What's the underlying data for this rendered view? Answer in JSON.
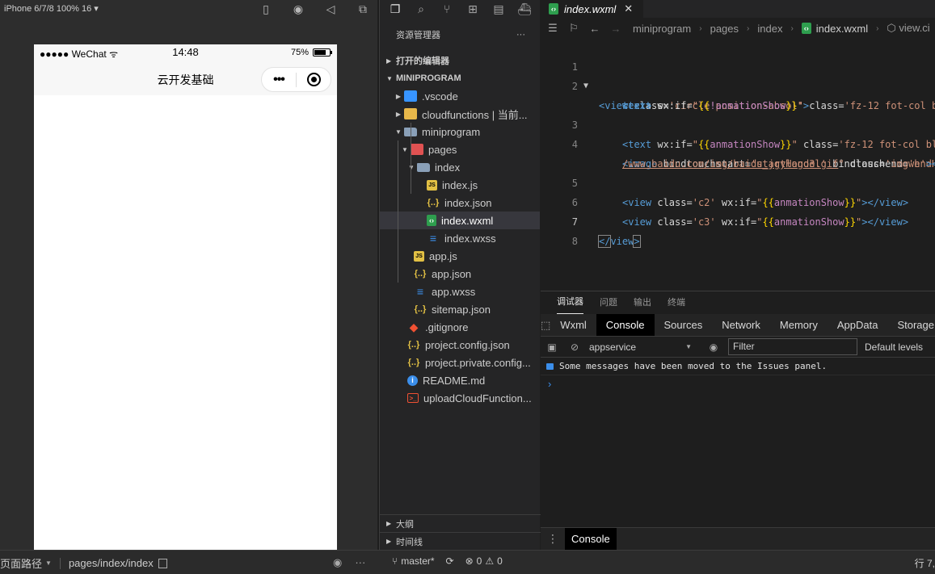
{
  "simulator": {
    "device_label": "iPhone 6/7/8 100% 16 ▾",
    "phone": {
      "carrier": "●●●●● WeChat",
      "time": "14:48",
      "battery_text": "75%",
      "battery_level": 0.75,
      "nav_title": "云开发基础",
      "capsule_more": "•••"
    }
  },
  "explorer": {
    "header": "资源管理器",
    "more": "···",
    "open_editors": "打开的编辑器",
    "project": "MINIPROGRAM",
    "tree": [
      {
        "label": ".vscode",
        "icon": "vscode-folder-icon",
        "depth": 0
      },
      {
        "label": "cloudfunctions | 当前...",
        "icon": "cloud-folder-icon",
        "depth": 0
      },
      {
        "label": "miniprogram",
        "icon": "folder-open-icon",
        "depth": 0
      },
      {
        "label": "pages",
        "icon": "pages-folder-icon",
        "depth": 1
      },
      {
        "label": "index",
        "icon": "folder-open-icon",
        "depth": 2
      },
      {
        "label": "index.js",
        "icon": "js-file-icon",
        "depth": 3
      },
      {
        "label": "index.json",
        "icon": "json-file-icon",
        "depth": 3
      },
      {
        "label": "index.wxml",
        "icon": "wxml-file-icon",
        "depth": 3,
        "selected": true
      },
      {
        "label": "index.wxss",
        "icon": "wxss-file-icon",
        "depth": 3
      },
      {
        "label": "app.js",
        "icon": "js-file-icon",
        "depth": 1
      },
      {
        "label": "app.json",
        "icon": "json-file-icon",
        "depth": 1
      },
      {
        "label": "app.wxss",
        "icon": "wxss-file-icon",
        "depth": 1
      },
      {
        "label": "sitemap.json",
        "icon": "json-file-icon",
        "depth": 1
      },
      {
        "label": ".gitignore",
        "icon": "git-file-icon",
        "depth": 0
      },
      {
        "label": "project.config.json",
        "icon": "json-file-icon",
        "depth": 0
      },
      {
        "label": "project.private.config...",
        "icon": "json-file-icon",
        "depth": 0
      },
      {
        "label": "README.md",
        "icon": "info-file-icon",
        "depth": 0
      },
      {
        "label": "uploadCloudFunction...",
        "icon": "shell-file-icon",
        "depth": 0
      }
    ],
    "outline": "大纲",
    "timeline": "时间线"
  },
  "editor": {
    "tab_label": "index.wxml",
    "tab_close": "✕",
    "breadcrumb": [
      "miniprogram",
      "pages",
      "index",
      "index.wxml",
      "view.ci"
    ],
    "lines": {
      "n1": "1",
      "n2": "2",
      "n3": "3",
      "n4": "4",
      "n5": "5",
      "n6": "6",
      "n7": "7",
      "n8": "8",
      "l1_a": "<view ",
      "l1_b": "class=",
      "l1_c": "'circle position-absol'",
      "l1_d": ">",
      "l2_a": "<text ",
      "l2_b": "wx:if=",
      "l2_c": "\"",
      "l2_d": "{{",
      "l2_e": "!anmationShow",
      "l2_f": "}}",
      "l2_g": "\" ",
      "l2_h": "class=",
      "l2_i": "'fz-12 fot-col b",
      "l2w": "text>",
      "l3_a": "<text ",
      "l3_b": "wx:if=",
      "l3_c": "\"",
      "l3_d": "{{",
      "l3_e": "anmationShow",
      "l3_f": "}}",
      "l3_g": "\" ",
      "l3_h": "class=",
      "l3_i": "'fz-12 fot-col bl",
      "l4_a": "<image ",
      "l4_b": "bindtouchstart=",
      "l4_c": "'startHandel' ",
      "l4_d": "bindtouchend=",
      "l4_e": "'endH",
      "l4w_a": "/www.baidu.com/img/baidu_jgylogo3.gif",
      "l4w_b": "\" ",
      "l4w_c": "class=",
      "l4w_d": "'imgwh'",
      "l4w_e": "><",
      "l5_a": "<view ",
      "l5_b": "class=",
      "l5_c": "'c2' ",
      "l5_d": "wx:if=",
      "l5_e": "\"",
      "l5_f": "{{",
      "l5_g": "anmationShow",
      "l5_h": "}}",
      "l5_i": "\"",
      "l5_j": "></view>",
      "l6_a": "<view ",
      "l6_b": "class=",
      "l6_c": "'c3' ",
      "l6_d": "wx:if=",
      "l6_e": "\"",
      "l6_f": "{{",
      "l6_g": "anmationShow",
      "l6_h": "}}",
      "l6_i": "\"",
      "l6_j": "></view>",
      "l7_a": "</",
      "l7_b": "view",
      "l7_c": ">"
    }
  },
  "debugger": {
    "tabs": [
      "调试器",
      "问题",
      "输出",
      "终端"
    ],
    "devtools_tabs": [
      "Wxml",
      "Console",
      "Sources",
      "Network",
      "Memory",
      "AppData",
      "Storage"
    ],
    "context": "appservice",
    "filter_placeholder": "Filter",
    "levels": "Default levels",
    "message": "Some messages have been moved to the Issues panel.",
    "prompt": "›",
    "drawer_tab": "Console"
  },
  "statusbar": {
    "page_path_label": "页面路径",
    "page_path": "pages/index/index",
    "branch": "master*",
    "errors": "0",
    "warnings": "0",
    "position": "行 7,"
  }
}
